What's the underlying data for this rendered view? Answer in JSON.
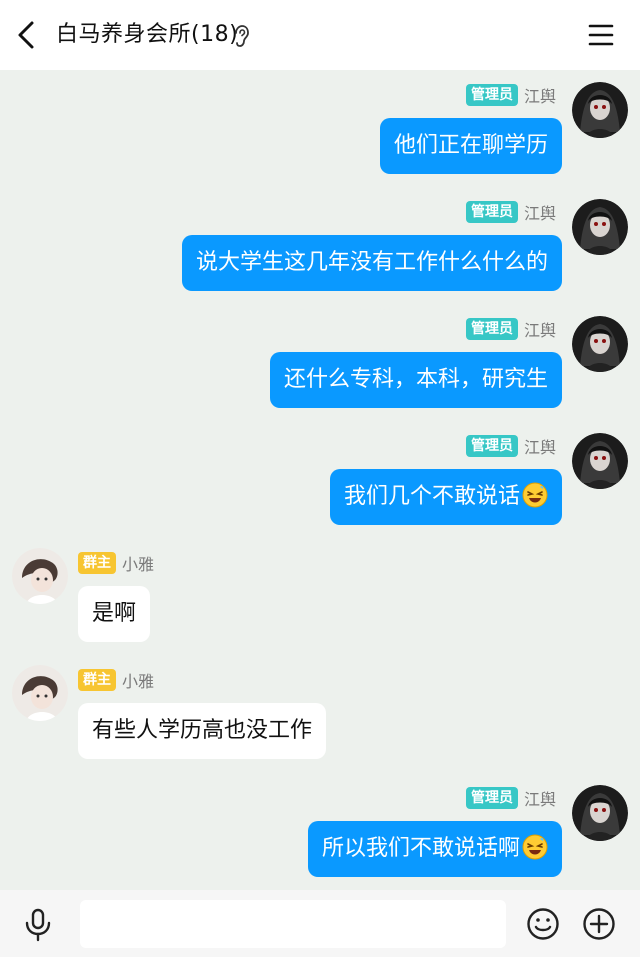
{
  "header": {
    "title": "白马养身会所(18)"
  },
  "messages": [
    {
      "side": "right",
      "badge": "管理员",
      "nick": "江舆",
      "text": "他们正在聊学历",
      "emoji": false
    },
    {
      "side": "right",
      "badge": "管理员",
      "nick": "江舆",
      "text": "说大学生这几年没有工作什么什么的",
      "emoji": false
    },
    {
      "side": "right",
      "badge": "管理员",
      "nick": "江舆",
      "text": "还什么专科，本科，研究生",
      "emoji": false
    },
    {
      "side": "right",
      "badge": "管理员",
      "nick": "江舆",
      "text": "我们几个不敢说话",
      "emoji": true
    },
    {
      "side": "left",
      "badge": "群主",
      "nick": "小雅",
      "text": "是啊",
      "emoji": false
    },
    {
      "side": "left",
      "badge": "群主",
      "nick": "小雅",
      "text": "有些人学历高也没工作",
      "emoji": false
    },
    {
      "side": "right",
      "badge": "管理员",
      "nick": "江舆",
      "text": "所以我们不敢说话啊",
      "emoji": true
    }
  ],
  "colors": {
    "background": "#edf1ed",
    "self_bubble": "#0a99ff",
    "admin_badge": "#37c7c6",
    "owner_badge": "#f7c531"
  },
  "icons": {
    "back": "chevron-left-icon",
    "ear": "ear-icon",
    "menu": "menu-icon",
    "mic": "microphone-icon",
    "emoji": "smiley-icon",
    "plus": "plus-circle-icon"
  }
}
